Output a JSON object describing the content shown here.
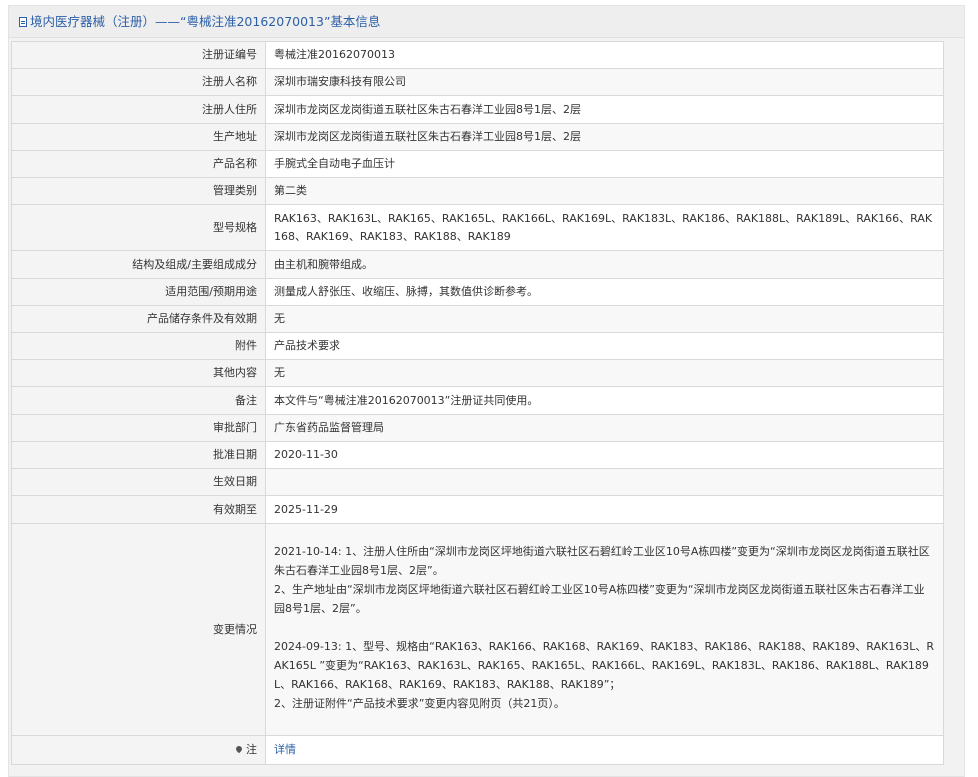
{
  "header": {
    "title": "境内医疗器械（注册）——“粤械注准20162070013”基本信息"
  },
  "rows": [
    {
      "label": "注册证编号",
      "value": "粤械注准20162070013"
    },
    {
      "label": "注册人名称",
      "value": "深圳市瑞安康科技有限公司"
    },
    {
      "label": "注册人住所",
      "value": "深圳市龙岗区龙岗街道五联社区朱古石春洋工业园8号1层、2层"
    },
    {
      "label": "生产地址",
      "value": "深圳市龙岗区龙岗街道五联社区朱古石春洋工业园8号1层、2层"
    },
    {
      "label": "产品名称",
      "value": "手腕式全自动电子血压计"
    },
    {
      "label": "管理类别",
      "value": "第二类"
    },
    {
      "label": "型号规格",
      "value": "RAK163、RAK163L、RAK165、RAK165L、RAK166L、RAK169L、RAK183L、RAK186、RAK188L、RAK189L、RAK166、RAK168、RAK169、RAK183、RAK188、RAK189"
    },
    {
      "label": "结构及组成/主要组成成分",
      "value": "由主机和腕带组成。"
    },
    {
      "label": "适用范围/预期用途",
      "value": "测量成人舒张压、收缩压、脉搏，其数值供诊断参考。"
    },
    {
      "label": "产品储存条件及有效期",
      "value": "无"
    },
    {
      "label": "附件",
      "value": "产品技术要求"
    },
    {
      "label": "其他内容",
      "value": "无"
    },
    {
      "label": "备注",
      "value": "本文件与“粤械注准20162070013”注册证共同使用。"
    },
    {
      "label": "审批部门",
      "value": "广东省药品监督管理局"
    },
    {
      "label": "批准日期",
      "value": "2020-11-30"
    },
    {
      "label": "生效日期",
      "value": ""
    },
    {
      "label": "有效期至",
      "value": "2025-11-29"
    }
  ],
  "changes": {
    "label": "变更情况",
    "text": "2021-10-14: 1、注册人住所由“深圳市龙岗区坪地街道六联社区石碧红岭工业区10号A栋四楼”变更为“深圳市龙岗区龙岗街道五联社区朱古石春洋工业园8号1层、2层”。\n2、生产地址由“深圳市龙岗区坪地街道六联社区石碧红岭工业区10号A栋四楼”变更为“深圳市龙岗区龙岗街道五联社区朱古石春洋工业园8号1层、2层”。\n\n2024-09-13: 1、型号、规格由“RAK163、RAK166、RAK168、RAK169、RAK183、RAK186、RAK188、RAK189、RAK163L、RAK165L ”变更为“RAK163、RAK163L、RAK165、RAK165L、RAK166L、RAK169L、RAK183L、RAK186、RAK188L、RAK189L、RAK166、RAK168、RAK169、RAK183、RAK188、RAK189”；\n2、注册证附件“产品技术要求”变更内容见附页（共21页）。"
  },
  "note": {
    "label": "注",
    "link": "详情"
  }
}
